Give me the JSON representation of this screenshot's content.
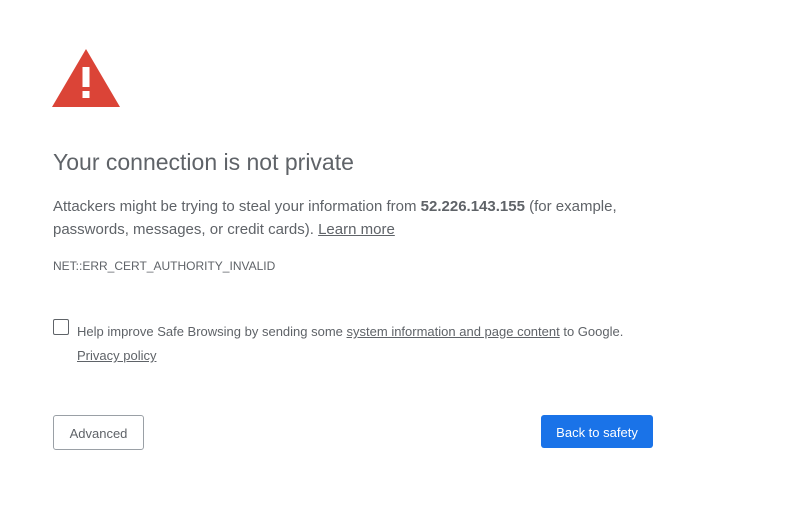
{
  "interstitial": {
    "icon": "warning-triangle-icon",
    "icon_color": "#db4437",
    "heading": "Your connection is not private",
    "message_prefix": "Attackers might be trying to steal your information from ",
    "host": "52.226.143.155",
    "message_suffix": " (for example, passwords, messages, or credit cards). ",
    "learn_more": "Learn more",
    "error_code": "NET::ERR_CERT_AUTHORITY_INVALID"
  },
  "optin": {
    "checked": false,
    "text_prefix": "Help improve Safe Browsing by sending some ",
    "link": "system information and page content",
    "text_suffix": " to Google. ",
    "privacy_link": "Privacy policy"
  },
  "buttons": {
    "advanced_label": "Advanced",
    "safety_label": "Back to safety",
    "primary_color": "#1a73e8"
  }
}
